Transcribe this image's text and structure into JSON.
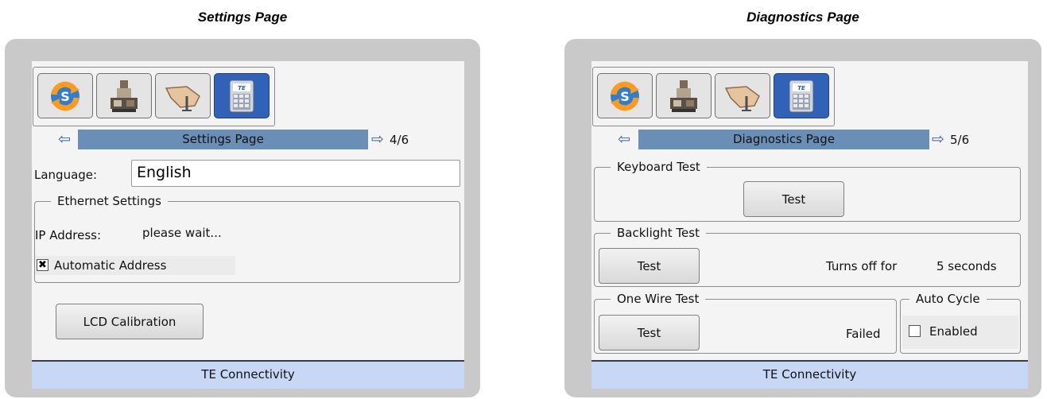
{
  "captions": {
    "left": "Settings Page",
    "right": "Diagnostics Page"
  },
  "settings": {
    "nav": {
      "prev_icon": "left-arrow-icon",
      "title": "Settings Page",
      "next_icon": "right-arrow-icon",
      "count": "4/6"
    },
    "language_label": "Language:",
    "language_value": "English",
    "ethernet": {
      "title": "Ethernet Settings",
      "ip_label": "IP Address:",
      "ip_value": "please wait...",
      "auto_address_label": "Automatic Address",
      "auto_address_checked": true
    },
    "lcd_calibration_label": "LCD Calibration",
    "footer": "TE Connectivity"
  },
  "diagnostics": {
    "nav": {
      "prev_icon": "left-arrow-icon",
      "title": "Diagnostics Page",
      "next_icon": "right-arrow-icon",
      "count": "5/6"
    },
    "keyboard": {
      "title": "Keyboard Test",
      "button": "Test"
    },
    "backlight": {
      "title": "Backlight Test",
      "button": "Test",
      "status_prefix": "Turns off for",
      "seconds": "5 seconds"
    },
    "onewire": {
      "title": "One Wire Test",
      "button": "Test",
      "result": "Failed"
    },
    "autocycle": {
      "title": "Auto Cycle",
      "label": "Enabled",
      "checked": false
    },
    "footer": "TE Connectivity"
  },
  "toolbar_icons": [
    "sync-icon",
    "printer-machine-icon",
    "cable-tool-icon",
    "te-device-icon"
  ],
  "arrows": {
    "left": "⇦",
    "right": "⇨"
  },
  "checkmark": "✖",
  "colors": {
    "nav_bar": "#6a8fb6",
    "footer": "#c6d8f6",
    "active_tab": "#2f62b8",
    "frame": "#c9c9c9"
  }
}
